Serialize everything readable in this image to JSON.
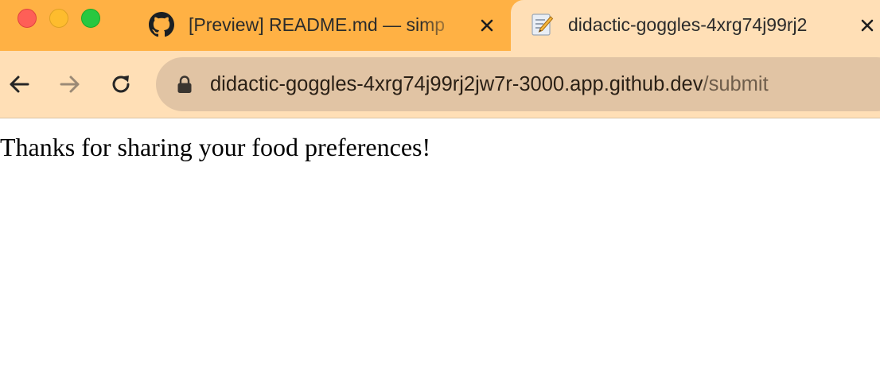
{
  "window": {
    "controls": [
      "close",
      "minimize",
      "zoom"
    ]
  },
  "tabs": [
    {
      "title": "[Preview] README.md — simp",
      "icon": "github-icon",
      "active": false
    },
    {
      "title": "didactic-goggles-4xrg74j99rj2",
      "icon": "memo-icon",
      "active": true
    }
  ],
  "toolbar": {
    "back_icon": "arrow-left-icon",
    "forward_icon": "arrow-right-icon",
    "reload_icon": "reload-icon",
    "address": {
      "host": "didactic-goggles-4xrg74j99rj2jw7r-3000.app.github.dev",
      "path": "/submit"
    }
  },
  "page": {
    "message": "Thanks for sharing your food preferences!"
  },
  "colors": {
    "tab_strip": "#ffb144",
    "active_tab": "#ffdfb6",
    "toolbar": "#ffdfb6",
    "omnibox": "#e1c4a4",
    "traffic_close": "#fe5f57",
    "traffic_minimize": "#febc2e",
    "traffic_zoom": "#28c840"
  }
}
